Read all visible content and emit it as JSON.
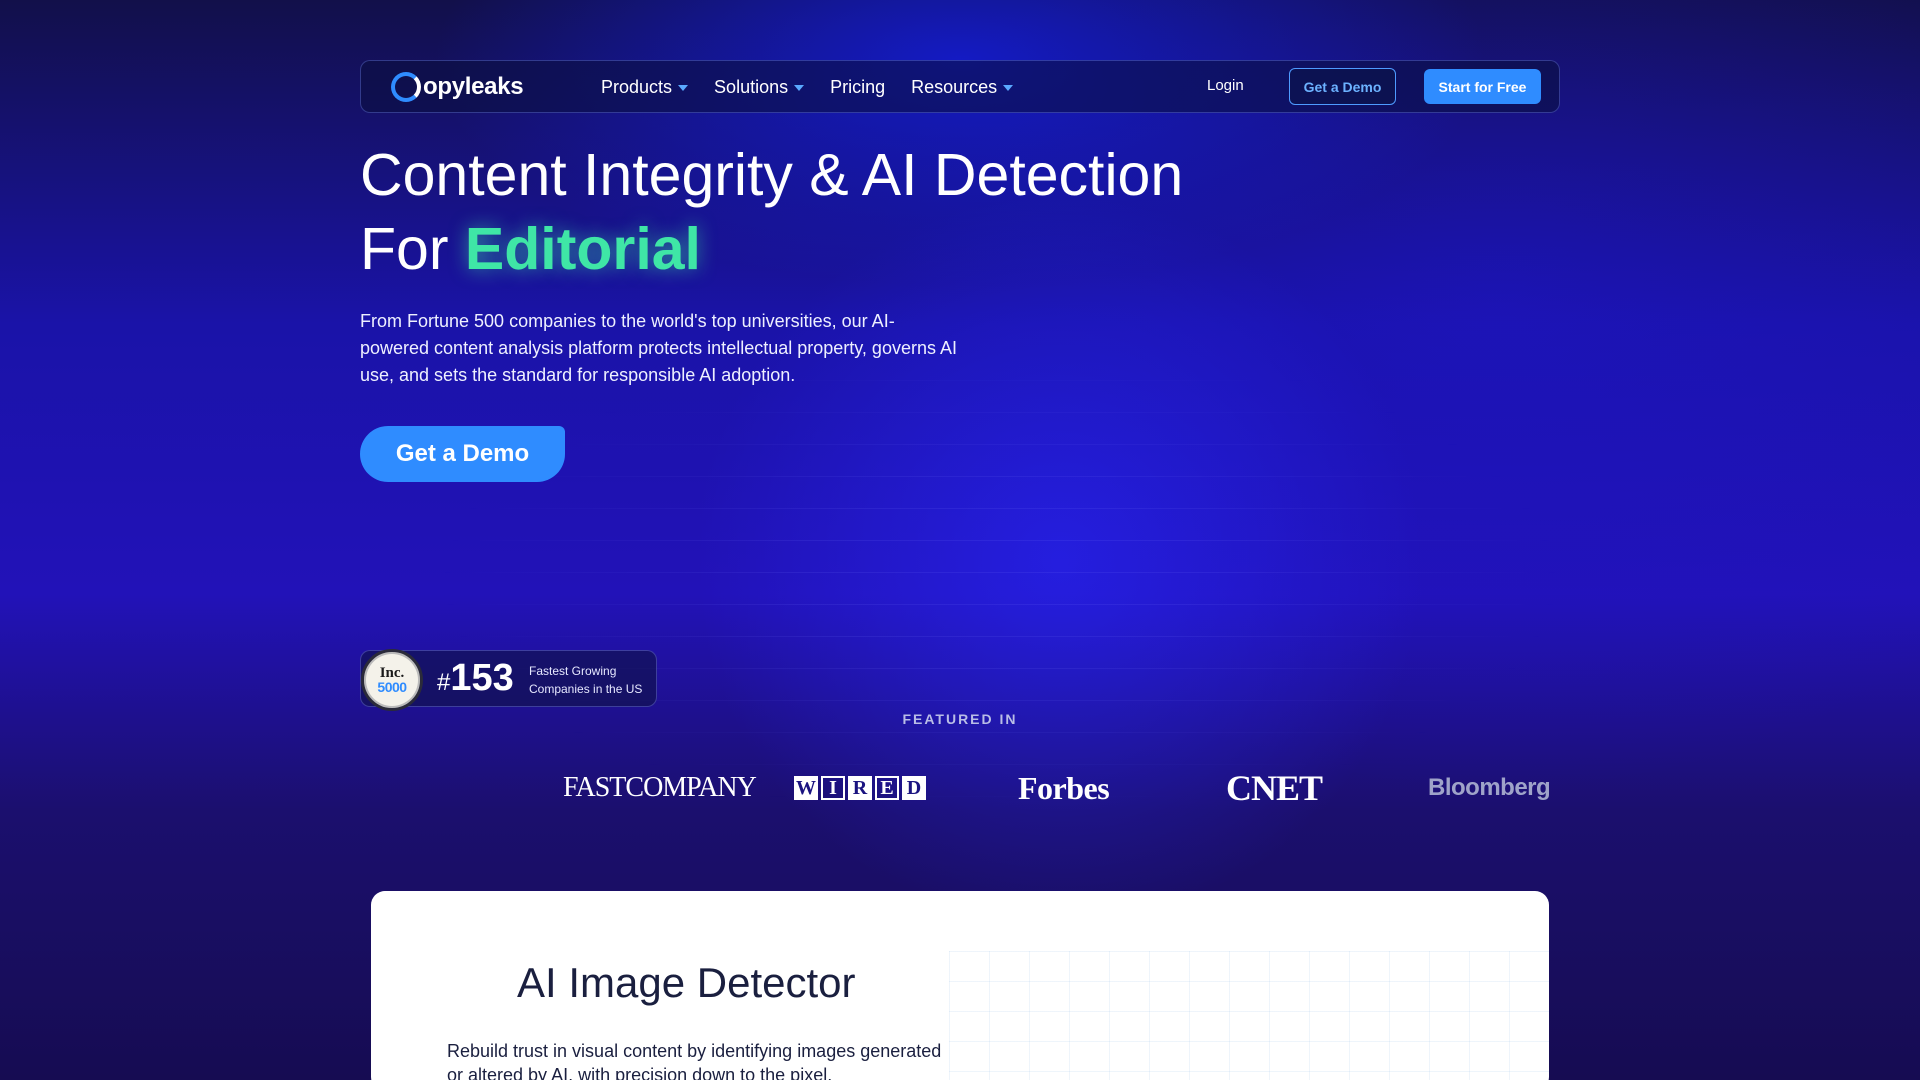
{
  "nav": {
    "logo_text": "opyleaks",
    "menu": [
      {
        "label": "Products",
        "has_dropdown": true
      },
      {
        "label": "Solutions",
        "has_dropdown": true
      },
      {
        "label": "Pricing",
        "has_dropdown": false
      },
      {
        "label": "Resources",
        "has_dropdown": true
      }
    ],
    "login": "Login",
    "demo_button": "Get a Demo",
    "start_button": "Start for Free"
  },
  "hero": {
    "title_line1": "Content Integrity & AI Detection",
    "title_prefix": "For ",
    "title_accent": "Editorial",
    "description": "From Fortune 500 companies to the world's top universities, our AI-powered content analysis platform protects intellectual property, governs AI use, and sets the standard for responsible AI adoption.",
    "cta": "Get a Demo"
  },
  "inc_badge": {
    "seal_word": "Inc.",
    "seal_number": "5000",
    "hash": "#",
    "rank": "153",
    "label": "Fastest Growing Companies in the US"
  },
  "featured": {
    "heading": "FEATURED IN",
    "logos": [
      "FASTCOMPANY",
      "WIRED",
      "Forbes",
      "CNET",
      "Bloomberg"
    ]
  },
  "card": {
    "title": "AI Image Detector",
    "description": "Rebuild trust in visual content by identifying images generated or altered by AI, with precision down to the pixel."
  },
  "colors": {
    "accent_blue": "#2f8cff",
    "accent_green": "#3fe6a6",
    "background": "#1a13a8"
  }
}
